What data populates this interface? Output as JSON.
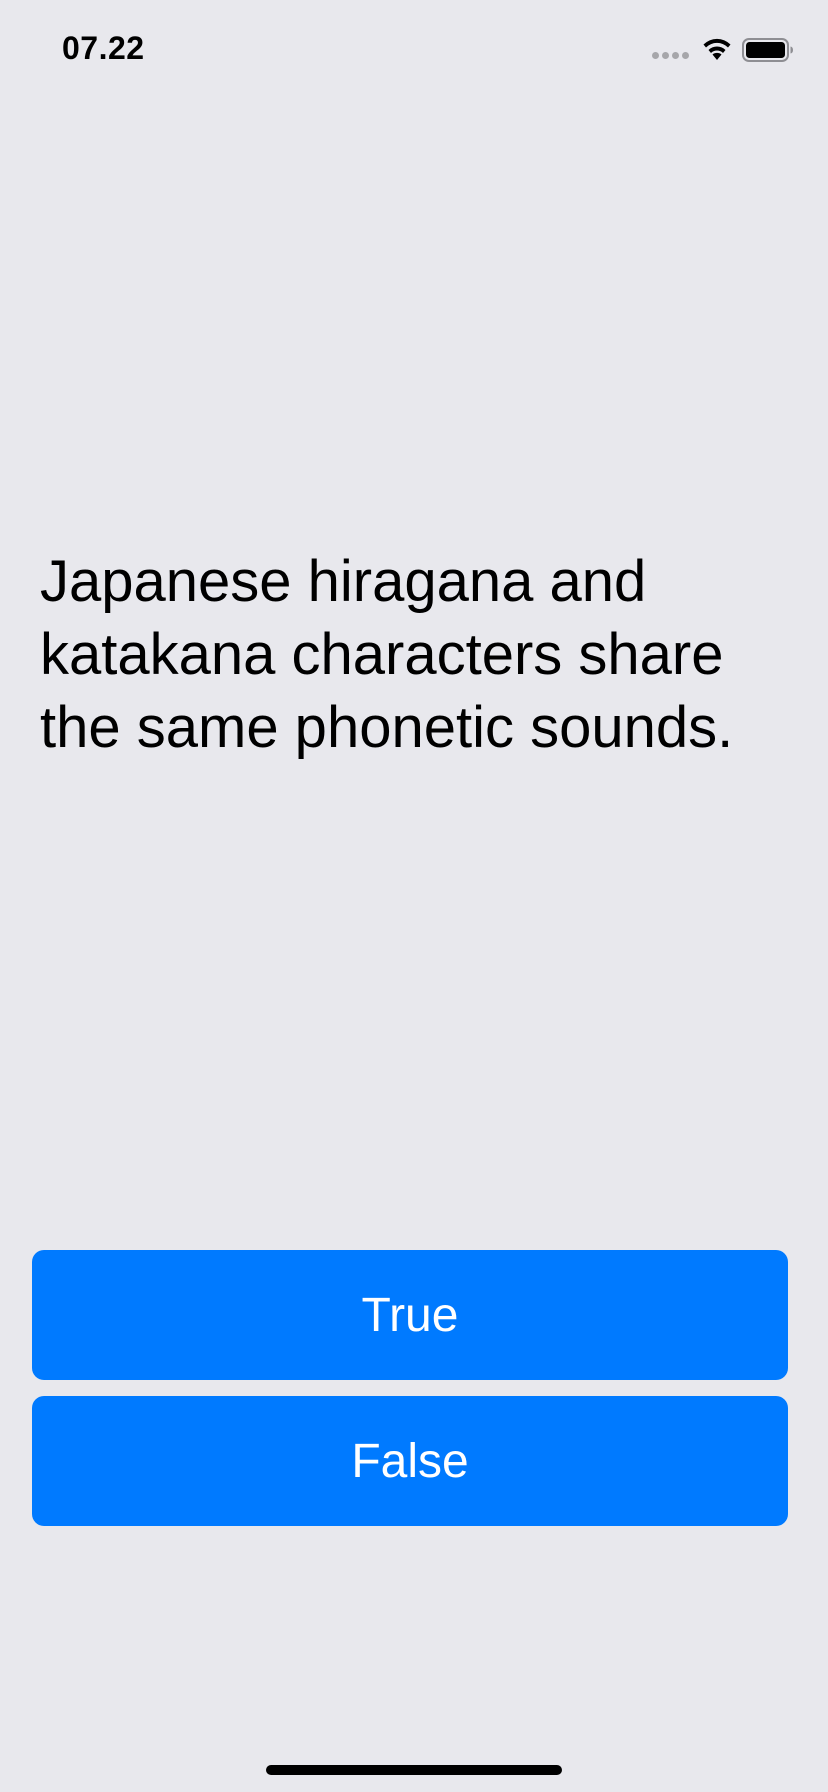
{
  "status_bar": {
    "time": "07.22",
    "icons": [
      "signal-dots-icon",
      "wifi-icon",
      "battery-icon"
    ]
  },
  "question": {
    "text": "Japanese hiragana and katakana characters share the same phonetic sounds."
  },
  "answers": {
    "true_label": "True",
    "false_label": "False"
  },
  "colors": {
    "background": "#e8e8ed",
    "button": "#007aff",
    "button_text": "#ffffff",
    "text": "#000000"
  }
}
